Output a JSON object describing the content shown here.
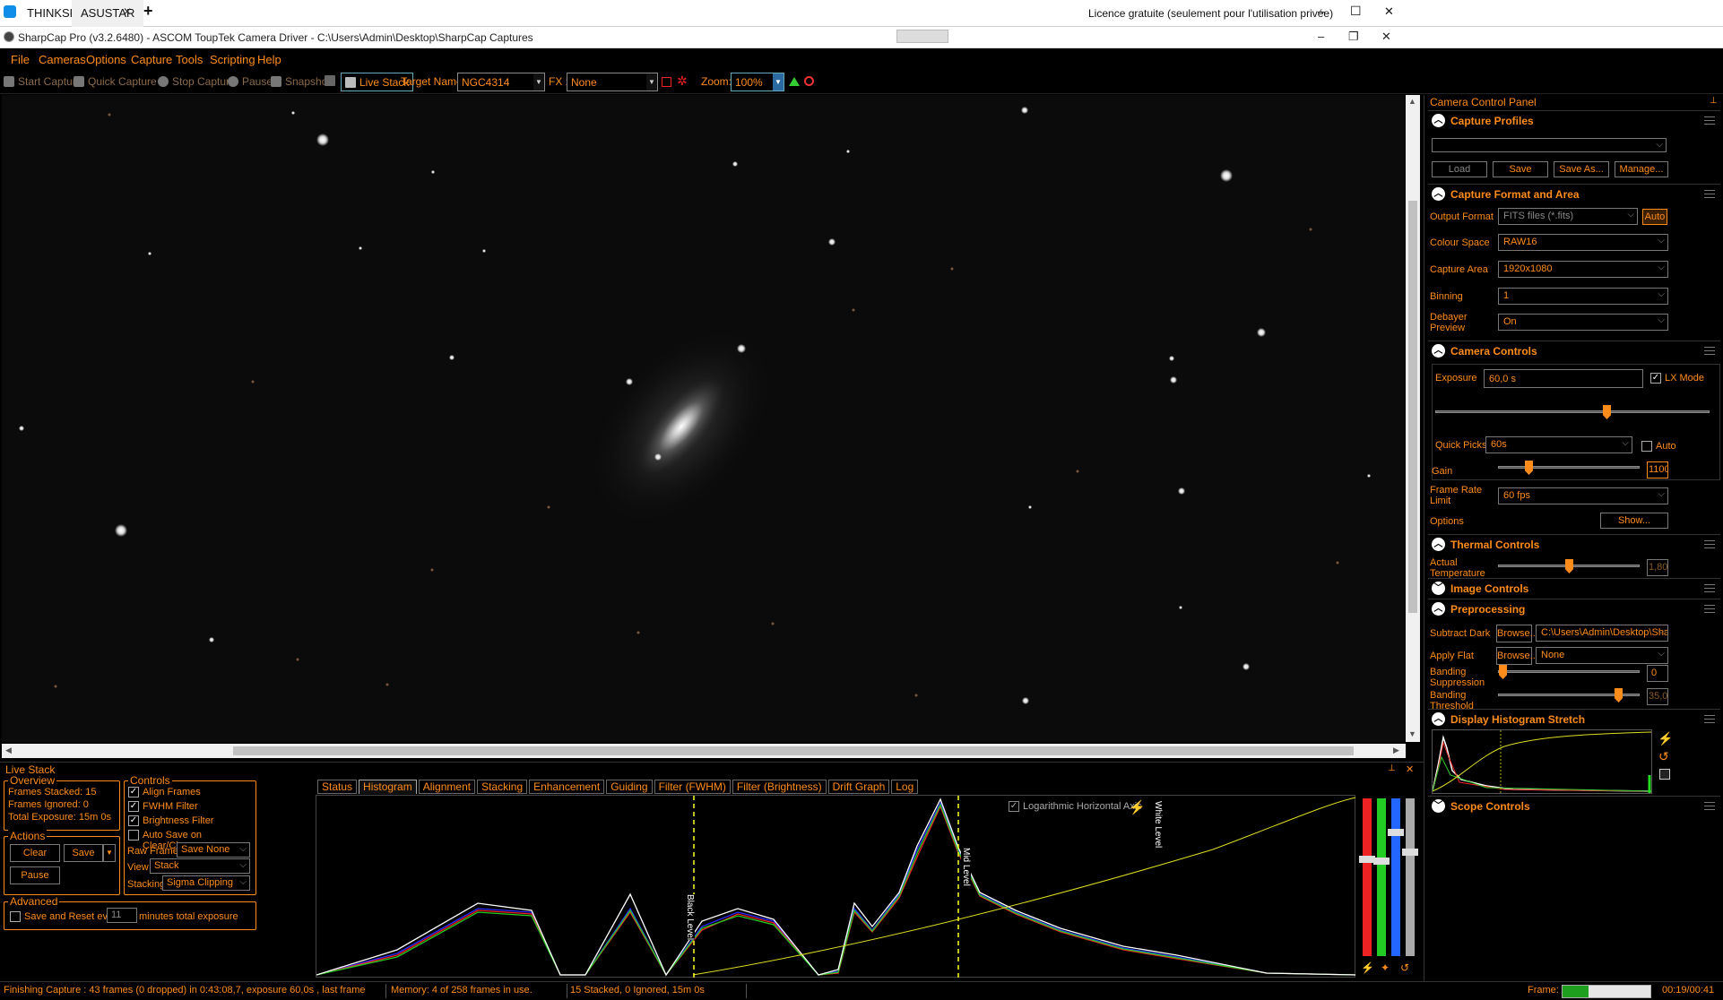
{
  "teamviewer": {
    "tab1": "THINKSKY",
    "tab2": "ASUSTAR",
    "add": "+",
    "licence": "Licence gratuite (seulement pour l'utilisation privée)",
    "minimize": "–",
    "maximize": "☐",
    "close": "✕"
  },
  "window": {
    "title": "SharpCap Pro (v3.2.6480) - ASCOM ToupTek Camera Driver - C:\\Users\\Admin\\Desktop\\SharpCap Captures",
    "minimize": "–",
    "restore": "❐",
    "close": "✕"
  },
  "menu": [
    "File",
    "Cameras",
    "Options",
    "Capture",
    "Tools",
    "Scripting",
    "Help"
  ],
  "toolbar": {
    "start_capture": "Start Capture",
    "quick_capture": "Quick Capture",
    "stop_capture": "Stop Capture",
    "pause": "Pause",
    "snapshot": "Snapshot",
    "live_stack": "Live Stack",
    "target_name_label": "Target Name :",
    "target_name": "NGC4314",
    "fx_label": "FX :",
    "fx": "None",
    "zoom_label": "Zoom:",
    "zoom": "100%"
  },
  "camera_panel": {
    "title": "Camera Control Panel",
    "capture_profiles": {
      "title": "Capture Profiles",
      "load": "Load",
      "save": "Save",
      "save_as": "Save As...",
      "manage": "Manage..."
    },
    "capture_format": {
      "title": "Capture Format and Area",
      "output_format_label": "Output Format",
      "output_format": "FITS files (*.fits)",
      "auto": "Auto",
      "colour_space_label": "Colour Space",
      "colour_space": "RAW16",
      "capture_area_label": "Capture Area",
      "capture_area": "1920x1080",
      "binning_label": "Binning",
      "binning": "1",
      "debayer_label1": "Debayer",
      "debayer_label2": "Preview",
      "debayer": "On"
    },
    "camera_controls": {
      "title": "Camera Controls",
      "exposure_label": "Exposure",
      "exposure": "60,0 s",
      "lx_mode": "LX Mode",
      "exposure_slider": 0.63,
      "quick_picks_label": "Quick Picks",
      "quick_picks": "60s",
      "auto": "Auto",
      "gain_label": "Gain",
      "gain": "1100",
      "gain_slider": 0.2,
      "frame_rate_label1": "Frame Rate",
      "frame_rate_label2": "Limit",
      "frame_rate": "60 fps",
      "options_label": "Options",
      "show": "Show..."
    },
    "thermal": {
      "title": "Thermal Controls",
      "temp_label1": "Actual",
      "temp_label2": "Temperature",
      "temp": "1,80",
      "temp_slider": 0.5
    },
    "image_controls": {
      "title": "Image Controls"
    },
    "preprocessing": {
      "title": "Preprocessing",
      "subtract_dark_label": "Subtract Dark",
      "browse": "Browse...",
      "dark_path": "C:\\Users\\Admin\\Desktop\\Sharp...",
      "apply_flat_label": "Apply Flat",
      "flat": "None",
      "banding_supp_label1": "Banding",
      "banding_supp_label2": "Suppression",
      "banding_supp": "0",
      "banding_supp_slider": 0.0,
      "banding_thr_label1": "Banding",
      "banding_thr_label2": "Threshold",
      "banding_thr": "35,0",
      "banding_thr_slider": 0.88
    },
    "display_histogram": {
      "title": "Display Histogram Stretch"
    },
    "scope_controls": {
      "title": "Scope Controls"
    }
  },
  "live_stack": {
    "title": "Live Stack",
    "overview": {
      "title": "Overview",
      "frames_stacked_label": "Frames Stacked:",
      "frames_stacked": "15",
      "frames_ignored_label": "Frames Ignored:",
      "frames_ignored": "0",
      "total_exposure_label": "Total Exposure:",
      "total_exposure": "15m 0s"
    },
    "actions": {
      "title": "Actions",
      "clear": "Clear",
      "save": "Save",
      "pause": "Pause"
    },
    "advanced": {
      "title": "Advanced",
      "save_reset": "Save and Reset every",
      "minutes": "11",
      "minutes_label": "minutes total exposure"
    },
    "controls": {
      "title": "Controls",
      "align": "Align Frames",
      "fwhm": "FWHM Filter",
      "brightness": "Brightness Filter",
      "autosave": "Auto Save on Clear/Close",
      "raw_frames_label": "Raw Frames",
      "raw_frames": "Save None",
      "view_label": "View",
      "view": "Stack",
      "stacking_label": "Stacking",
      "stacking": "Sigma Clipping"
    },
    "tabs": [
      "Status",
      "Histogram",
      "Alignment",
      "Stacking",
      "Enhancement",
      "Guiding",
      "Filter (FWHM)",
      "Filter (Brightness)",
      "Drift Graph",
      "Log"
    ],
    "active_tab": "Histogram",
    "log_axis": "Logarithmic Horizontal Axis",
    "black_level": "Black Level",
    "mid_level": "Mid Level",
    "white_level": "White Level"
  },
  "status": {
    "capture": "Finishing Capture : 43 frames (0 dropped) in 0:43:08,7, exposure 60,0s , last frame",
    "memory": "Memory: 4 of 258 frames in use.",
    "stacked": "15 Stacked, 0 Ignored, 15m 0s",
    "frame_label": "Frame:",
    "time": "00:19/00:41",
    "frame_progress": 0.3
  },
  "colors": {
    "accent": "#ff8c1a",
    "background": "#000000",
    "teamviewer_blue": "#0e8ee9"
  }
}
